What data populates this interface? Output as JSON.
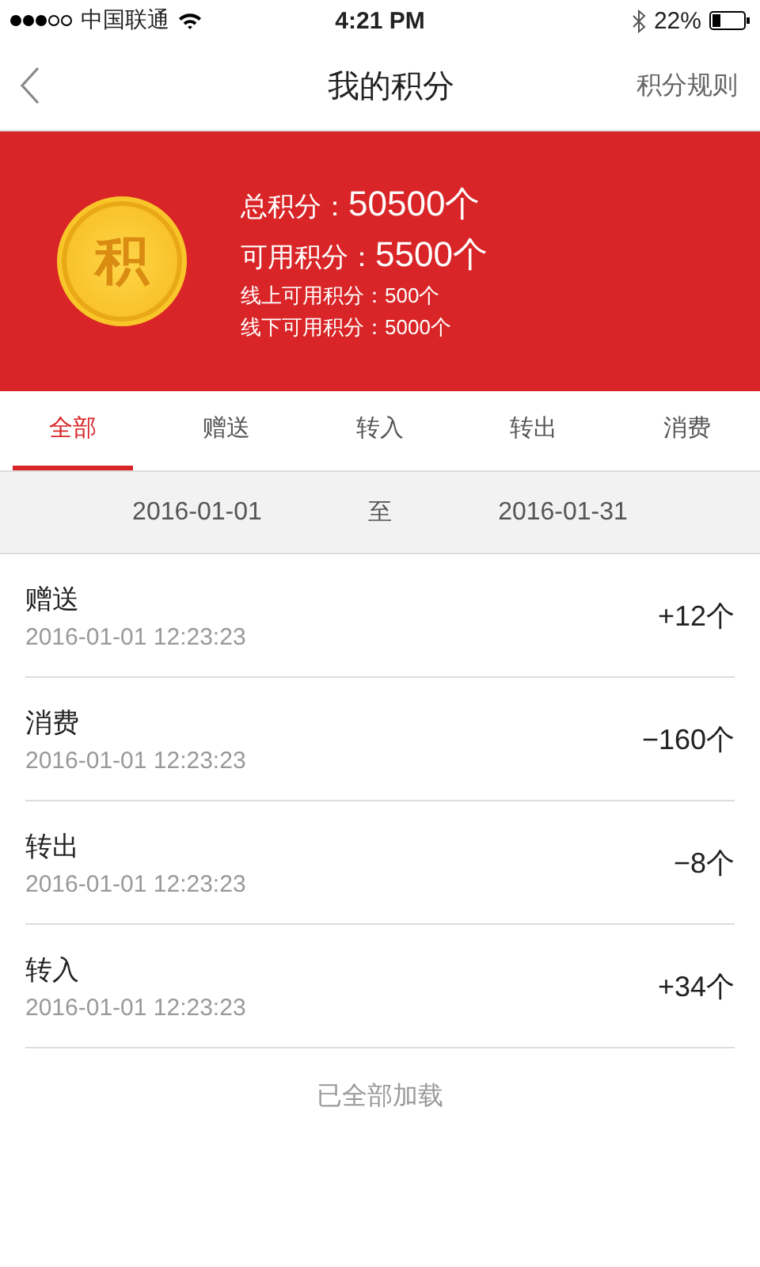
{
  "status_bar": {
    "carrier": "中国联通",
    "time": "4:21 PM",
    "battery": "22%"
  },
  "nav": {
    "title": "我的积分",
    "action": "积分规则"
  },
  "summary": {
    "coin": "积",
    "lines": [
      {
        "kind": "main",
        "label": "总积分：",
        "value": "50500个"
      },
      {
        "kind": "main",
        "label": "可用积分：",
        "value": "5500个"
      },
      {
        "kind": "sub",
        "label": "线上可用积分：",
        "value": "500个"
      },
      {
        "kind": "sub",
        "label": "线下可用积分：",
        "value": "5000个"
      }
    ]
  },
  "tabs": [
    {
      "label": "全部",
      "selected": true
    },
    {
      "label": "赠送",
      "selected": false
    },
    {
      "label": "转入",
      "selected": false
    },
    {
      "label": "转出",
      "selected": false
    },
    {
      "label": "消费",
      "selected": false
    }
  ],
  "date_range": {
    "start": "2016-01-01",
    "separator": "至",
    "end": "2016-01-31"
  },
  "records": [
    {
      "type": "赠送",
      "time": "2016-01-01 12:23:23",
      "amount": "+12个"
    },
    {
      "type": "消费",
      "time": "2016-01-01 12:23:23",
      "amount": "−160个"
    },
    {
      "type": "转出",
      "time": "2016-01-01 12:23:23",
      "amount": "−8个"
    },
    {
      "type": "转入",
      "time": "2016-01-01 12:23:23",
      "amount": "+34个"
    }
  ],
  "footer": "已全部加载"
}
